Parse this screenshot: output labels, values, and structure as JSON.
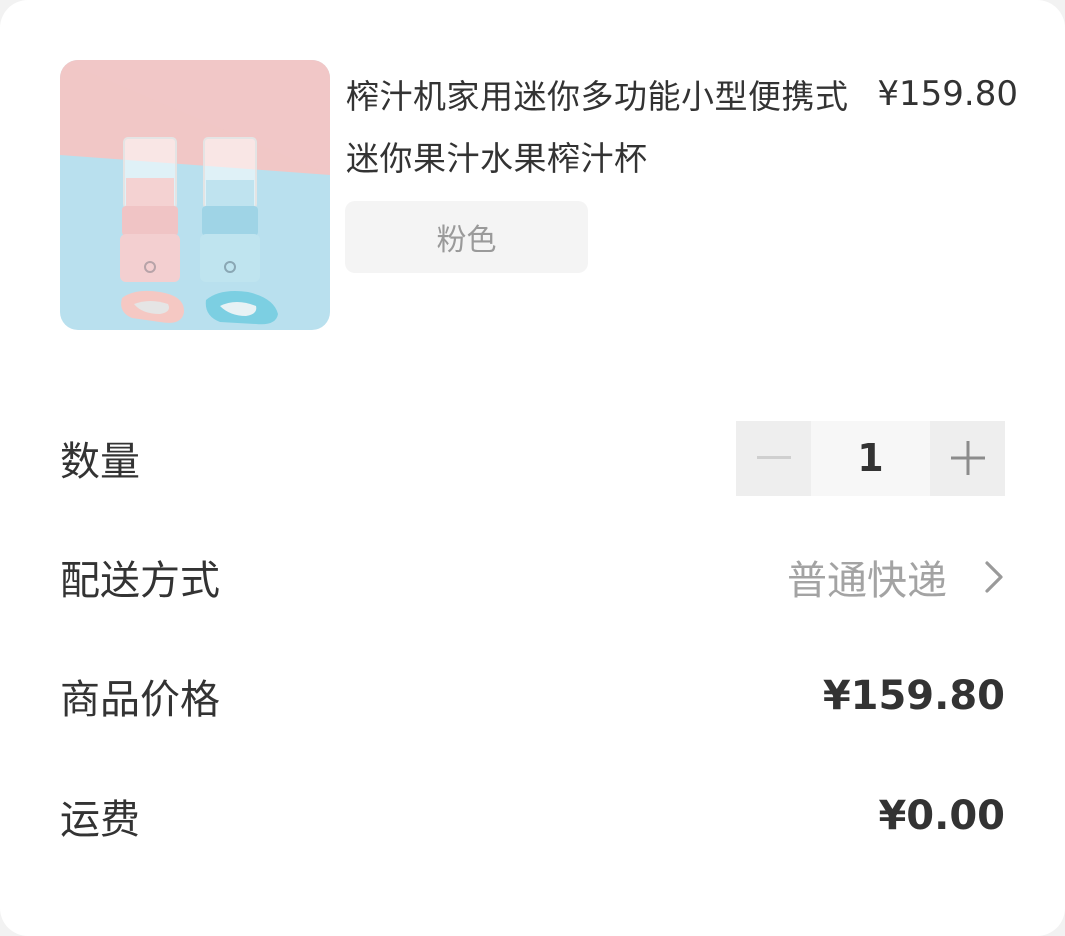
{
  "product": {
    "title": "榨汁机家用迷你多功能小型便携式迷你果汁水果榨汁杯",
    "unit_price": "¥159.80",
    "spec": "粉色",
    "image_colors": {
      "pink_bg": "#f2c6c6",
      "blue_bg": "#b7dfee"
    }
  },
  "quantity": {
    "label": "数量",
    "value": "1",
    "decrement_icon": "minus-icon",
    "increment_icon": "plus-icon"
  },
  "delivery": {
    "label": "配送方式",
    "value": "普通快递",
    "icon": "chevron-right-icon"
  },
  "goods_price": {
    "label": "商品价格",
    "value": "¥159.80"
  },
  "shipping_fee": {
    "label": "运费",
    "value": "¥0.00"
  }
}
